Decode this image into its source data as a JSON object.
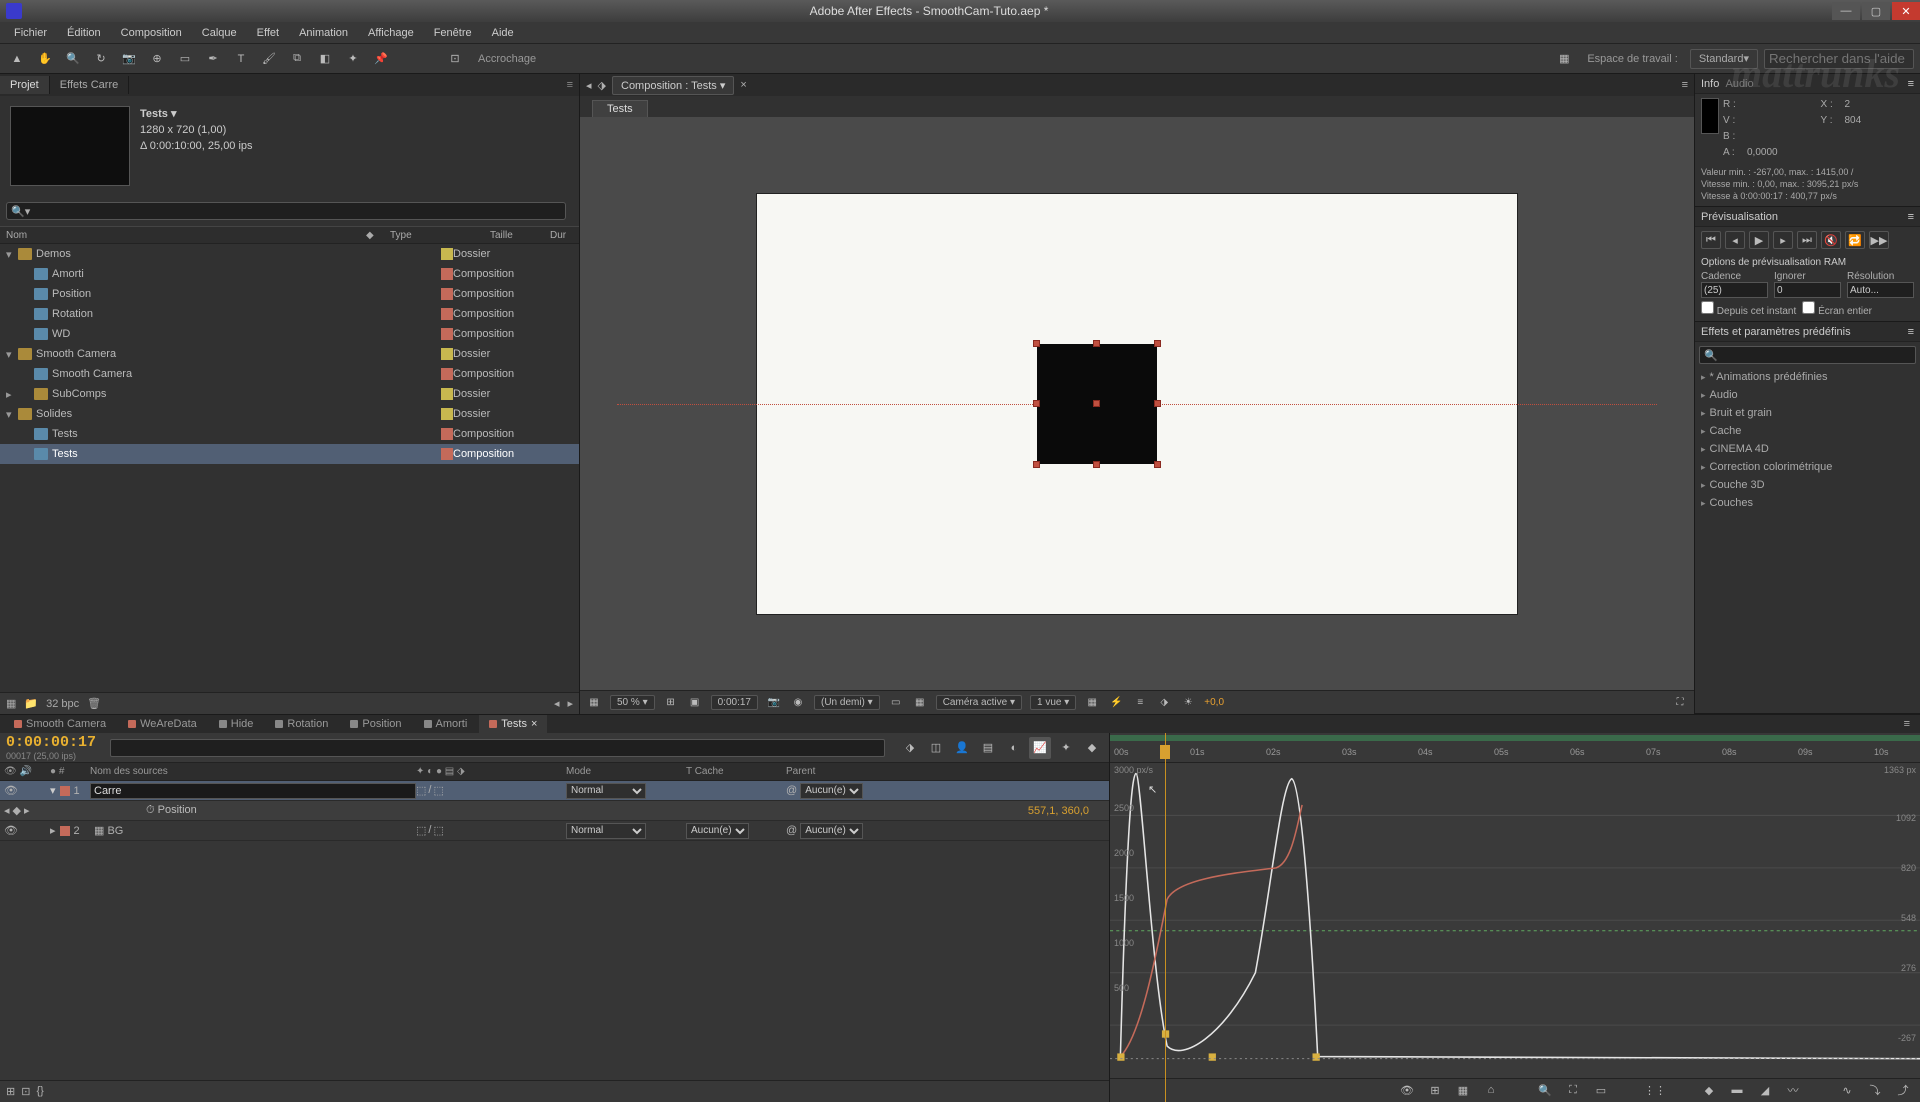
{
  "app": {
    "title": "Adobe After Effects - SmoothCam-Tuto.aep *",
    "watermark": "mattrunks"
  },
  "menu": [
    "Fichier",
    "Édition",
    "Composition",
    "Calque",
    "Effet",
    "Animation",
    "Affichage",
    "Fenêtre",
    "Aide"
  ],
  "toolbar": {
    "snap": "Accrochage",
    "workspace_label": "Espace de travail :",
    "workspace_value": "Standard",
    "search_placeholder": "Rechercher dans l'aide"
  },
  "project": {
    "tab1": "Projet",
    "tab2": "Effets Carre",
    "sel_name": "Tests ▾",
    "sel_dims": "1280 x 720 (1,00)",
    "sel_dur": "Δ 0:00:10:00, 25,00 ips",
    "cols": {
      "name": "Nom",
      "type": "Type",
      "size": "Taille",
      "dur": "Dur"
    },
    "items": [
      {
        "indent": 0,
        "kind": "folder",
        "name": "Demos",
        "swatch": "sw-yellow",
        "type": "Dossier",
        "open": true
      },
      {
        "indent": 1,
        "kind": "comp",
        "name": "Amorti",
        "swatch": "sw-red",
        "type": "Composition"
      },
      {
        "indent": 1,
        "kind": "comp",
        "name": "Position",
        "swatch": "sw-red",
        "type": "Composition"
      },
      {
        "indent": 1,
        "kind": "comp",
        "name": "Rotation",
        "swatch": "sw-red",
        "type": "Composition"
      },
      {
        "indent": 1,
        "kind": "comp",
        "name": "WD",
        "swatch": "sw-red",
        "type": "Composition"
      },
      {
        "indent": 0,
        "kind": "folder",
        "name": "Smooth Camera",
        "swatch": "sw-yellow",
        "type": "Dossier",
        "open": true
      },
      {
        "indent": 1,
        "kind": "comp",
        "name": "Smooth Camera",
        "swatch": "sw-red",
        "type": "Composition"
      },
      {
        "indent": 1,
        "kind": "folder",
        "name": "SubComps",
        "swatch": "sw-yellow",
        "type": "Dossier"
      },
      {
        "indent": 0,
        "kind": "folder",
        "name": "Solides",
        "swatch": "sw-yellow",
        "type": "Dossier",
        "open": true
      },
      {
        "indent": 1,
        "kind": "comp",
        "name": "Tests",
        "swatch": "sw-red",
        "type": "Composition"
      },
      {
        "indent": 1,
        "kind": "comp",
        "name": "Tests",
        "swatch": "sw-red",
        "type": "Composition",
        "selected": true
      }
    ],
    "bpc": "32 bpc"
  },
  "composition": {
    "dropdown": "Composition : Tests",
    "tab": "Tests",
    "footer": {
      "zoom": "50 %",
      "time": "0:00:17",
      "res": "(Un demi)",
      "camera": "Caméra active",
      "views": "1 vue",
      "exposure": "+0,0"
    }
  },
  "info": {
    "title": "Info",
    "audio_tab": "Audio",
    "R": "R :",
    "V": "V :",
    "B": "B :",
    "A": "A :",
    "Aval": "0,0000",
    "X": "X :",
    "Xval": "2",
    "Y": "Y :",
    "Yval": "804",
    "line1": "Valeur min. : -267,00, max. : 1415,00 /",
    "line2": "Vitesse min. : 0,00, max. : 3095,21 px/s",
    "line3": "Vitesse à 0:00:00:17 : 400,77 px/s"
  },
  "preview": {
    "title": "Prévisualisation",
    "ram_title": "Options de prévisualisation RAM",
    "cadence": "Cadence",
    "ignorer": "Ignorer",
    "resolution": "Résolution",
    "cadence_val": "(25)",
    "ignorer_val": "0",
    "resolution_val": "Auto...",
    "cb1": "Depuis cet instant",
    "cb2": "Écran entier"
  },
  "effects": {
    "title": "Effets et paramètres prédéfinis",
    "cats": [
      "* Animations prédéfinies",
      "Audio",
      "Bruit et grain",
      "Cache",
      "CINEMA 4D",
      "Correction colorimétrique",
      "Couche 3D",
      "Couches"
    ]
  },
  "timeline": {
    "tabs": [
      {
        "label": "Smooth Camera",
        "color": "#c46a5a"
      },
      {
        "label": "WeAreData",
        "color": "#c46a5a"
      },
      {
        "label": "Hide",
        "color": "#888"
      },
      {
        "label": "Rotation",
        "color": "#888"
      },
      {
        "label": "Position",
        "color": "#888"
      },
      {
        "label": "Amorti",
        "color": "#888"
      },
      {
        "label": "Tests",
        "color": "#c46a5a",
        "active": true
      }
    ],
    "timecode": "0:00:00:17",
    "timecode_sub": "00017 (25,00 ips)",
    "col_name": "Nom des sources",
    "col_mode": "Mode",
    "col_trk": "T Cache",
    "col_parent": "Parent",
    "layer1_num": "1",
    "layer1_name": "Carre",
    "layer1_mode": "Normal",
    "layer1_parent": "Aucun(e)",
    "prop_name": "Position",
    "prop_val": "557,1, 360,0",
    "layer2_num": "2",
    "layer2_name": "BG",
    "layer2_mode": "Normal",
    "layer2_trk": "Aucun(e)",
    "layer2_parent": "Aucun(e)",
    "ruler": [
      "00s",
      "01s",
      "02s",
      "03s",
      "04s",
      "05s",
      "06s",
      "07s",
      "08s",
      "09s",
      "10s"
    ],
    "graph_top_left": "3000 px/s",
    "graph_labels_right": [
      "1363 px",
      "1092",
      "820",
      "548",
      "276",
      "-267"
    ],
    "graph_labels_left": [
      "2500",
      "2000",
      "1500",
      "1000",
      "500"
    ]
  }
}
